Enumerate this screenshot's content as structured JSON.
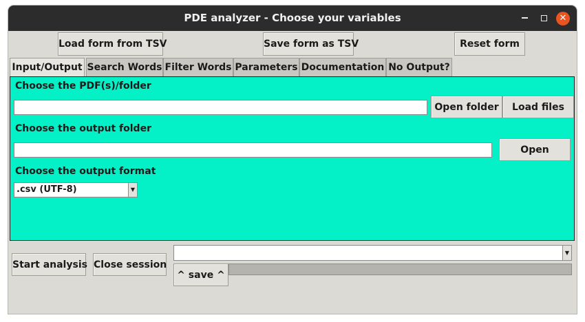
{
  "window": {
    "title": "PDE analyzer - Choose your variables"
  },
  "toolbar": {
    "load_tsv": "Load form from TSV",
    "save_tsv": "Save form as TSV",
    "reset": "Reset form"
  },
  "tabs": [
    {
      "label": "Input/Output",
      "active": true
    },
    {
      "label": "Search Words",
      "active": false
    },
    {
      "label": "Filter Words",
      "active": false
    },
    {
      "label": "Parameters",
      "active": false
    },
    {
      "label": "Documentation",
      "active": false
    },
    {
      "label": "No Output?",
      "active": false
    }
  ],
  "io": {
    "pdf_label": "Choose the PDF(s)/folder",
    "pdf_value": "",
    "open_folder": "Open folder",
    "load_files": "Load files",
    "out_label": "Choose the output folder",
    "out_value": "",
    "open": "Open",
    "format_label": "Choose the output format",
    "format_selected": ".csv (UTF-8)"
  },
  "bottom": {
    "start": "Start analysis",
    "close": "Close session",
    "session_value": "",
    "save": "^ save ^",
    "progress": 0
  },
  "colors": {
    "panel": "#04f1c7",
    "titlebar": "#2c2c2c",
    "close": "#e95420"
  }
}
